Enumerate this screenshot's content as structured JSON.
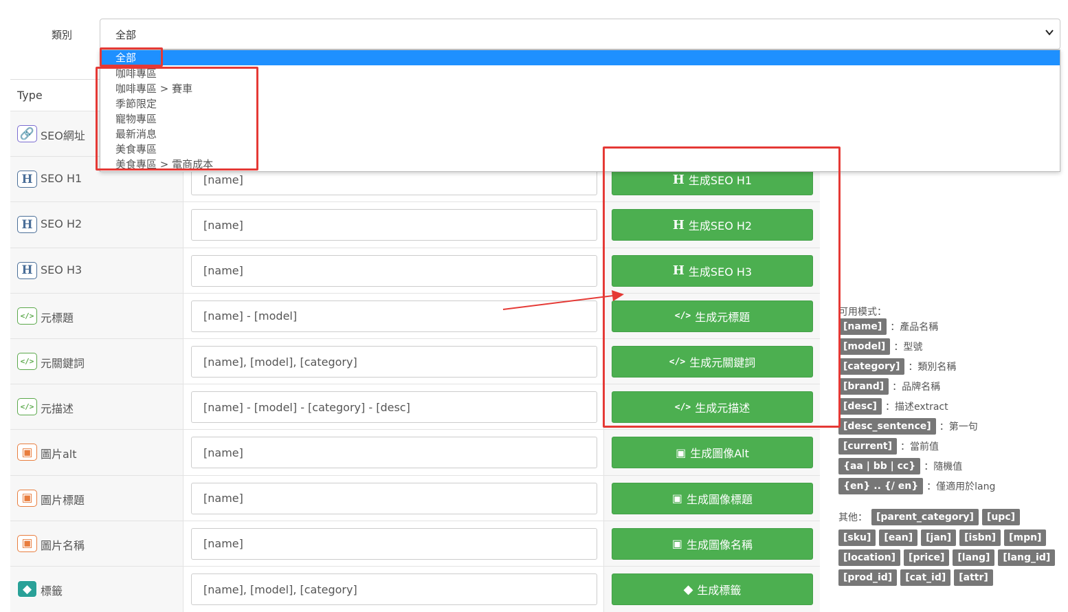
{
  "category": {
    "label": "類別",
    "selected": "全部",
    "options": [
      {
        "text": "全部",
        "selected": true
      },
      {
        "text": "咖啡專區"
      },
      {
        "text": "咖啡專區 > 賽車"
      },
      {
        "text": "季節限定"
      },
      {
        "text": "寵物專區"
      },
      {
        "text": "最新消息"
      },
      {
        "text": "美食專區"
      },
      {
        "text": "美食專區 > 電商成本"
      }
    ]
  },
  "table": {
    "header_type": "Type",
    "rows": [
      {
        "label": "SEO網址",
        "icon": "link-icon",
        "value": "",
        "button": ""
      },
      {
        "label": "SEO H1",
        "icon": "heading-icon",
        "value": "[name]",
        "button": "生成SEO H1"
      },
      {
        "label": "SEO H2",
        "icon": "heading-icon",
        "value": "[name]",
        "button": "生成SEO H2"
      },
      {
        "label": "SEO H3",
        "icon": "heading-icon",
        "value": "[name]",
        "button": "生成SEO H3"
      },
      {
        "label": "元標題",
        "icon": "code-icon",
        "value": "[name] - [model]",
        "button": "生成元標題"
      },
      {
        "label": "元關鍵詞",
        "icon": "code-icon",
        "value": "[name], [model], [category]",
        "button": "生成元關鍵詞"
      },
      {
        "label": "元描述",
        "icon": "code-icon",
        "value": "[name] - [model] - [category] - [desc]",
        "button": "生成元描述"
      },
      {
        "label": "圖片alt",
        "icon": "image-icon",
        "value": "[name]",
        "button": "生成圖像Alt"
      },
      {
        "label": "圖片標題",
        "icon": "image-icon",
        "value": "[name]",
        "button": "生成圖像標題"
      },
      {
        "label": "圖片名稱",
        "icon": "image-icon",
        "value": "[name]",
        "button": "生成圖像名稱"
      },
      {
        "label": "標籤",
        "icon": "tag-icon",
        "value": "[name], [model], [category]",
        "button": "生成標籤"
      }
    ]
  },
  "help": {
    "title": "可用模式：",
    "patterns": [
      {
        "tag": "[name]",
        "desc": "：產品名稱"
      },
      {
        "tag": "[model]",
        "desc": "：型號"
      },
      {
        "tag": "[category]",
        "desc": "：類別名稱"
      },
      {
        "tag": "[brand]",
        "desc": "：品牌名稱"
      },
      {
        "tag": "[desc]",
        "desc": "：描述extract"
      },
      {
        "tag": "[desc_sentence]",
        "desc": "：第一句"
      },
      {
        "tag": "[current]",
        "desc": "：當前值"
      },
      {
        "tag": "{aa | bb | cc}",
        "desc": "：隨機值"
      },
      {
        "tag": "{en} .. {/ en}",
        "desc": "：僅適用於lang"
      }
    ],
    "other_label": "其他：",
    "others": [
      "[parent_category]",
      "[upc]",
      "[sku]",
      "[ean]",
      "[jan]",
      "[isbn]",
      "[mpn]",
      "[location]",
      "[price]",
      "[lang]",
      "[lang_id]",
      "[prod_id]",
      "[cat_id]",
      "[attr]"
    ]
  },
  "colors": {
    "button_green": "#4caf50",
    "highlight_blue": "#1e90ff",
    "annotation_red": "#e53935",
    "badge_gray": "#777777"
  }
}
